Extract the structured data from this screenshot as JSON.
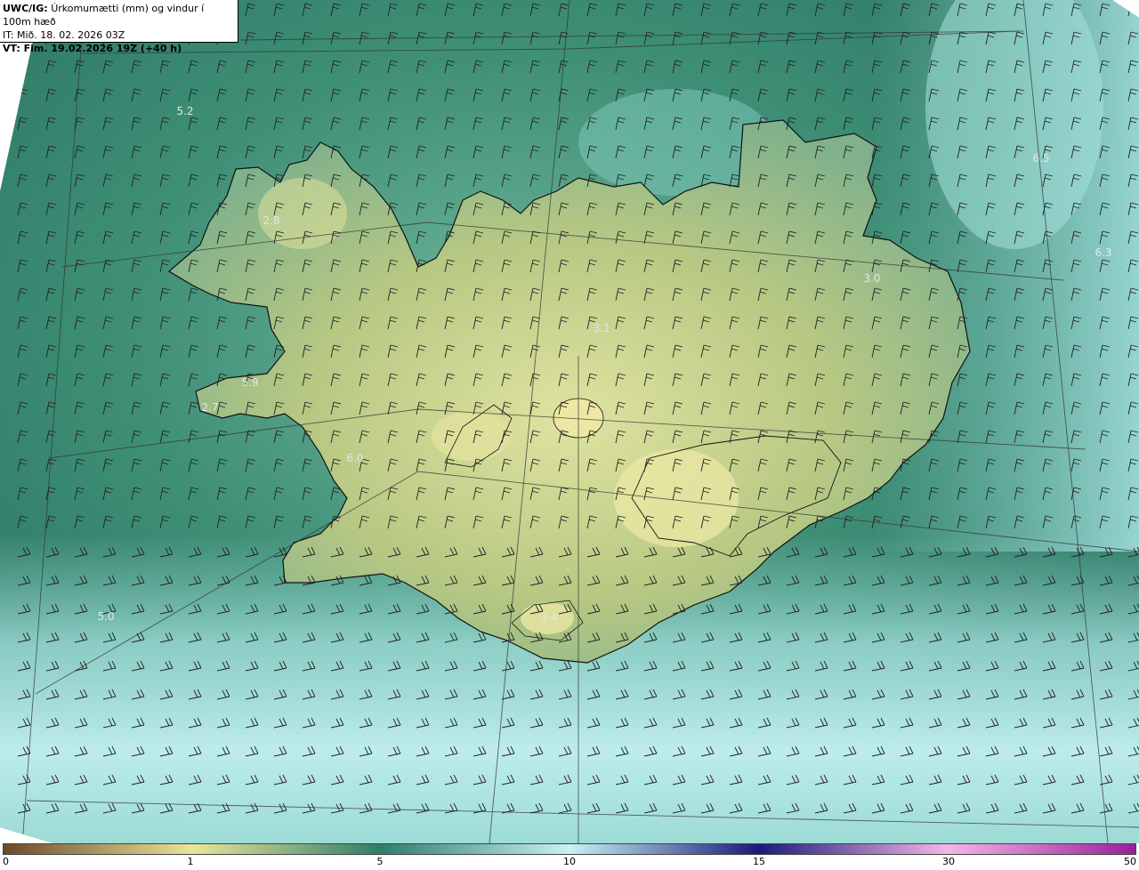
{
  "header": {
    "model": "UWC/IG:",
    "title": "Úrkomumætti (mm) og vindur í 100m hæð",
    "issued": "IT: Mið. 18. 02. 2026 03Z",
    "valid": "VT: Fim. 19.02.2026 19Z (+40 h)"
  },
  "labels": [
    {
      "id": "label-1",
      "text": "5.2"
    },
    {
      "id": "label-2",
      "text": "2.8"
    },
    {
      "id": "label-3",
      "text": "5.9"
    },
    {
      "id": "label-4",
      "text": "2.7"
    },
    {
      "id": "label-5",
      "text": "6.0"
    },
    {
      "id": "label-6",
      "text": "5.0"
    },
    {
      "id": "label-7",
      "text": "3.1"
    },
    {
      "id": "label-8",
      "text": "3.0"
    },
    {
      "id": "label-9",
      "text": "6.5"
    },
    {
      "id": "label-10",
      "text": "6.3"
    },
    {
      "id": "label-11",
      "text": "3.4"
    }
  ],
  "legend": {
    "ticks": [
      {
        "value": 0,
        "text": "0"
      },
      {
        "value": 1,
        "text": "1"
      },
      {
        "value": 5,
        "text": "5"
      },
      {
        "value": 10,
        "text": "10"
      },
      {
        "value": 15,
        "text": "15"
      },
      {
        "value": 30,
        "text": "30"
      },
      {
        "value": 50,
        "text": "50"
      }
    ],
    "max": 50,
    "stops": [
      {
        "value": 0,
        "color": "#6a4a2a"
      },
      {
        "value": 1,
        "color": "#e9e59a"
      },
      {
        "value": 5,
        "color": "#2e7d6a"
      },
      {
        "value": 10,
        "color": "#c8f2f4"
      },
      {
        "value": 15,
        "color": "#1a1a7a"
      },
      {
        "value": 30,
        "color": "#f5b6e8"
      },
      {
        "value": 50,
        "color": "#9a1e9a"
      }
    ]
  },
  "colors": {
    "sea_dark": "#2f7a6a",
    "sea_light": "#b6ecec",
    "land_low": "#c9cf82",
    "coast": "#111111"
  }
}
